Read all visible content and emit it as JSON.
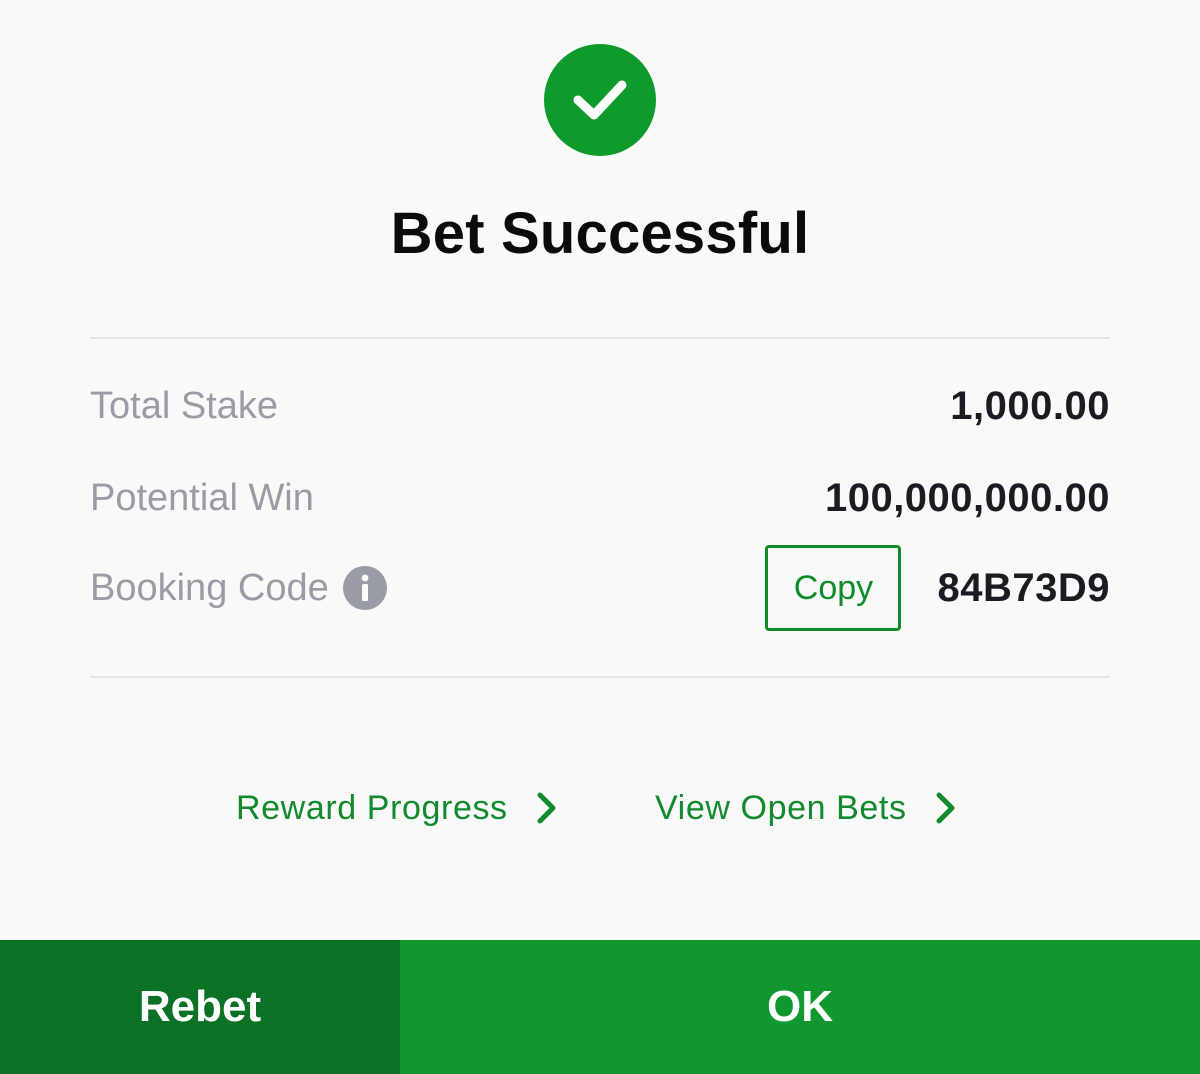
{
  "header": {
    "icon": "checkmark-circle-icon",
    "title": "Bet Successful"
  },
  "summary": {
    "total_stake": {
      "label": "Total Stake",
      "value": "1,000.00"
    },
    "potential_win": {
      "label": "Potential Win",
      "value": "100,000,000.00"
    },
    "booking_code": {
      "label": "Booking Code",
      "info_icon": "info-icon",
      "copy_label": "Copy",
      "value": "84B73D9"
    }
  },
  "links": {
    "reward_progress": "Reward Progress",
    "view_open_bets": "View Open Bets"
  },
  "actions": {
    "rebet": "Rebet",
    "ok": "OK"
  },
  "colors": {
    "success_green": "#0f9b2c",
    "rebet_bg": "#0b7125",
    "ok_bg": "#10982f",
    "link_green": "#138a2d",
    "label_gray": "#9a9ca5",
    "background": "#f9f9fa"
  }
}
